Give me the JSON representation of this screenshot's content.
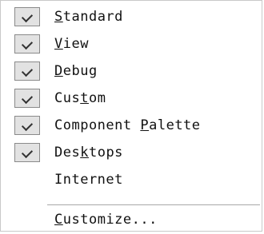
{
  "menu": {
    "items": [
      {
        "label": "Standard",
        "mnemonic_index": 0,
        "checked": true
      },
      {
        "label": "View",
        "mnemonic_index": 0,
        "checked": true
      },
      {
        "label": "Debug",
        "mnemonic_index": 0,
        "checked": true
      },
      {
        "label": "Custom",
        "mnemonic_index": 3,
        "checked": true
      },
      {
        "label": "Component Palette",
        "mnemonic_index": 10,
        "checked": true
      },
      {
        "label": "Desktops",
        "mnemonic_index": 3,
        "checked": true
      },
      {
        "label": "Internet",
        "mnemonic_index": -1,
        "checked": false
      }
    ],
    "footer": {
      "label": "Customize...",
      "mnemonic_index": 0
    },
    "icons": {
      "check": "checkmark-icon"
    }
  }
}
